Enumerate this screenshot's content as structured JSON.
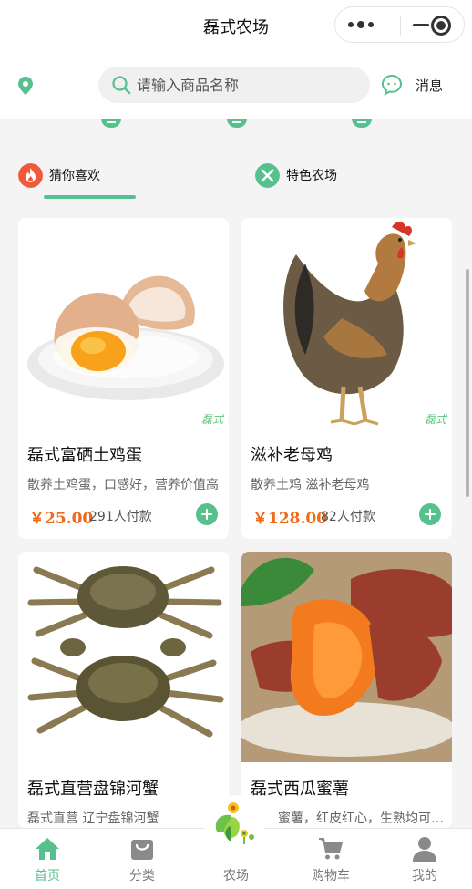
{
  "nav": {
    "title": "磊式农场"
  },
  "search": {
    "placeholder": "请输入商品名称",
    "message_label": "消息"
  },
  "tabs": [
    {
      "label": "猜你喜欢",
      "icon": "flame-icon",
      "color": "#f05a3a",
      "active": true
    },
    {
      "label": "特色农场",
      "icon": "farm-fork-icon",
      "color": "#56c08f",
      "active": false
    }
  ],
  "products": [
    {
      "name": "磊式富硒土鸡蛋",
      "desc": "散养土鸡蛋，口感好，营养价值高",
      "price": "￥25.00",
      "sold": "291人付款",
      "brand": "磊式",
      "image": "egg-image"
    },
    {
      "name": "滋补老母鸡",
      "desc": "散养土鸡 滋补老母鸡",
      "price": "￥128.00",
      "sold": "82人付款",
      "brand": "磊式",
      "image": "hen-image"
    },
    {
      "name": "磊式直营盘锦河蟹",
      "desc": "磊式直营 辽宁盘锦河蟹",
      "image": "crab-image"
    },
    {
      "name": "磊式西瓜蜜薯",
      "desc": "蜜薯，红皮红心，生熟均可食用",
      "image": "sweet-potato-image"
    }
  ],
  "tabbar": [
    {
      "label": "首页",
      "icon": "home-icon",
      "active": true
    },
    {
      "label": "分类",
      "icon": "bag-icon",
      "active": false
    },
    {
      "label": "农场",
      "icon": "farm-sprout-icon",
      "active": false
    },
    {
      "label": "购物车",
      "icon": "cart-icon",
      "active": false
    },
    {
      "label": "我的",
      "icon": "person-icon",
      "active": false
    }
  ],
  "colors": {
    "accent": "#56c08f",
    "price": "#ef6a1b",
    "background": "#f4f4f4"
  }
}
